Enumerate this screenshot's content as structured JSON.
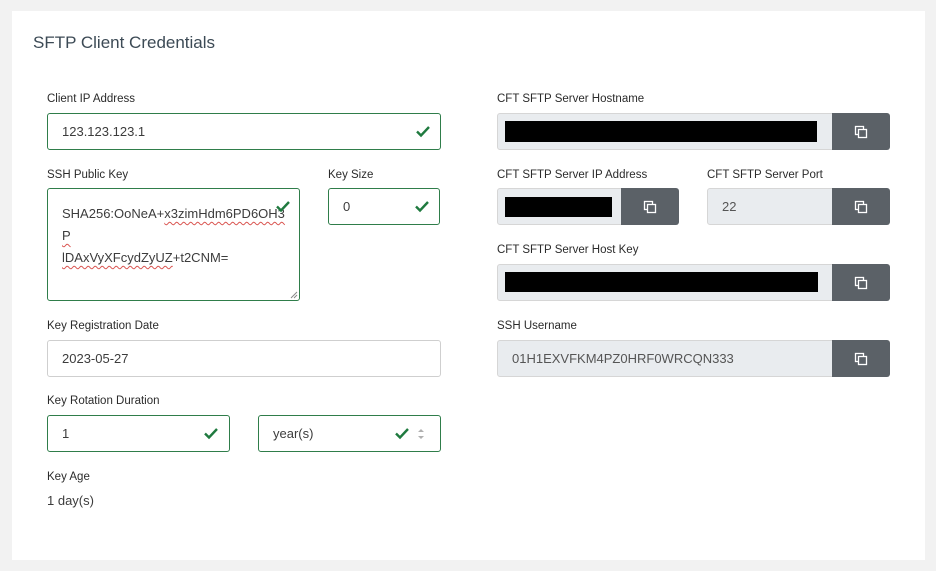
{
  "title": "SFTP Client Credentials",
  "client_ip": {
    "label": "Client IP Address",
    "value": "123.123.123.1"
  },
  "ssh_public_key": {
    "label": "SSH Public Key",
    "line1_prefix": "SHA256:OoNeA+",
    "line1_rest": "x3zimHdm6PD6OH3P",
    "line2_a": "lDAxVyXFcydZyUZ",
    "line2_b": "+t2CNM="
  },
  "key_size": {
    "label": "Key Size",
    "value": "0"
  },
  "key_registration_date": {
    "label": "Key Registration Date",
    "value": "2023-05-27"
  },
  "key_rotation_duration": {
    "label": "Key Rotation Duration",
    "value": "1",
    "unit": "year(s)"
  },
  "key_age": {
    "label": "Key Age",
    "value": "1 day(s)"
  },
  "server_hostname": {
    "label": "CFT SFTP Server Hostname"
  },
  "server_ip": {
    "label": "CFT SFTP Server IP Address"
  },
  "server_port": {
    "label": "CFT SFTP Server Port",
    "value": "22"
  },
  "server_host_key": {
    "label": "CFT SFTP Server Host Key"
  },
  "ssh_username": {
    "label": "SSH Username",
    "value": "01H1EXVFKM4PZ0HRF0WRCQN333"
  },
  "colors": {
    "valid": "#2f7d4a",
    "copy_button": "#5b6167",
    "readonly_bg": "#e9ecef"
  }
}
